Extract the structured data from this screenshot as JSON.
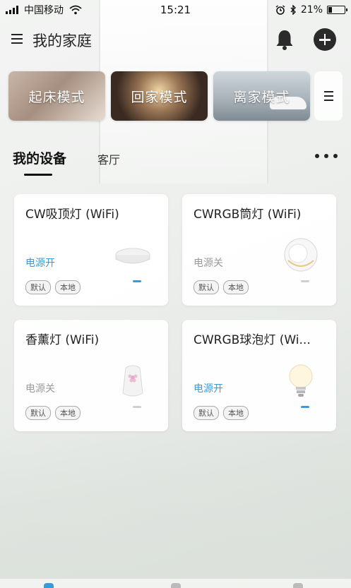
{
  "status_bar": {
    "carrier": "中国移动",
    "time": "15:21",
    "battery_percent": "21%",
    "battery_level": 0.21,
    "icons": [
      "signal-icon",
      "wifi-icon",
      "alarm-icon",
      "bluetooth-icon",
      "battery-icon"
    ]
  },
  "header": {
    "title": "我的家庭",
    "icons": [
      "menu-icon",
      "bell-icon",
      "add-icon"
    ]
  },
  "scenes": {
    "items": [
      {
        "label": "起床模式"
      },
      {
        "label": "回家模式"
      },
      {
        "label": "离家模式"
      }
    ],
    "more_icon": "menu-icon"
  },
  "tabs": {
    "active": "我的设备",
    "room": "客厅",
    "more_icon": "more-icon"
  },
  "devices": [
    {
      "name": "CW吸顶灯 (WiFi)",
      "power": "电源开",
      "on": true,
      "tags": [
        "默认",
        "本地"
      ],
      "icon": "ceiling-light-icon"
    },
    {
      "name": "CWRGB筒灯 (WiFi)",
      "power": "电源关",
      "on": false,
      "tags": [
        "默认",
        "本地"
      ],
      "icon": "downlight-icon"
    },
    {
      "name": "香薰灯 (WiFi)",
      "power": "电源关",
      "on": false,
      "tags": [
        "默认",
        "本地"
      ],
      "icon": "aroma-lamp-icon"
    },
    {
      "name": "CWRGB球泡灯 (Wi...",
      "power": "电源开",
      "on": true,
      "tags": [
        "默认",
        "本地"
      ],
      "icon": "bulb-icon"
    }
  ],
  "colors": {
    "accent": "#3a9ad9",
    "off_text": "#9a9a9a",
    "text": "#222222"
  }
}
